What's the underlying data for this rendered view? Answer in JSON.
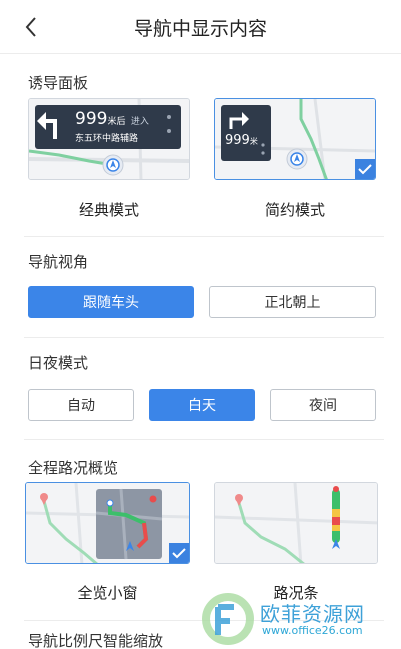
{
  "header": {
    "title": "导航中显示内容",
    "back_icon": "chevron-left-icon"
  },
  "guidance_panel": {
    "title": "诱导面板",
    "options": [
      {
        "label": "经典模式",
        "selected": false,
        "distance": "999",
        "unit": "米后",
        "action": "进入",
        "road": "东五环中路辅路"
      },
      {
        "label": "简约模式",
        "selected": true,
        "distance": "999",
        "unit": "米"
      }
    ]
  },
  "nav_view": {
    "title": "导航视角",
    "options": [
      {
        "label": "跟随车头",
        "active": true
      },
      {
        "label": "正北朝上",
        "active": false
      }
    ]
  },
  "day_night": {
    "title": "日夜模式",
    "options": [
      {
        "label": "自动",
        "active": false
      },
      {
        "label": "白天",
        "active": true
      },
      {
        "label": "夜间",
        "active": false
      }
    ]
  },
  "overview": {
    "title": "全程路况概览",
    "options": [
      {
        "label": "全览小窗",
        "selected": true
      },
      {
        "label": "路况条",
        "selected": false
      }
    ]
  },
  "scale": {
    "title": "导航比例尺智能缩放"
  },
  "watermark": {
    "text": "欧菲资源网",
    "url": "www.office26.com"
  },
  "colors": {
    "accent": "#3b85e8",
    "route_green": "#3dbf6b",
    "route_red": "#e94c4c",
    "route_yellow": "#f4c542"
  }
}
